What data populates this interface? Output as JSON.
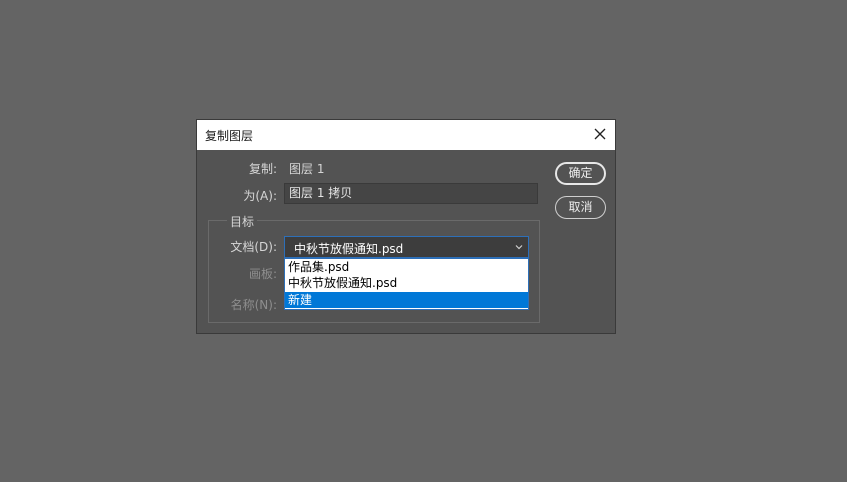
{
  "dialog": {
    "title": "复制图层",
    "copy_label": "复制:",
    "copy_value": "图层 1",
    "as_label": "为(A):",
    "as_value": "图层 1 拷贝",
    "target_group": "目标",
    "document_label": "文档(D):",
    "document_selected": "中秋节放假通知.psd",
    "document_options": [
      "作品集.psd",
      "中秋节放假通知.psd",
      "新建"
    ],
    "artboard_label": "画板:",
    "name_label": "名称(N):",
    "ok_button": "确定",
    "cancel_button": "取消"
  },
  "colors": {
    "background": "#646464",
    "dialog_bg": "#535353",
    "accent": "#0078d7"
  }
}
